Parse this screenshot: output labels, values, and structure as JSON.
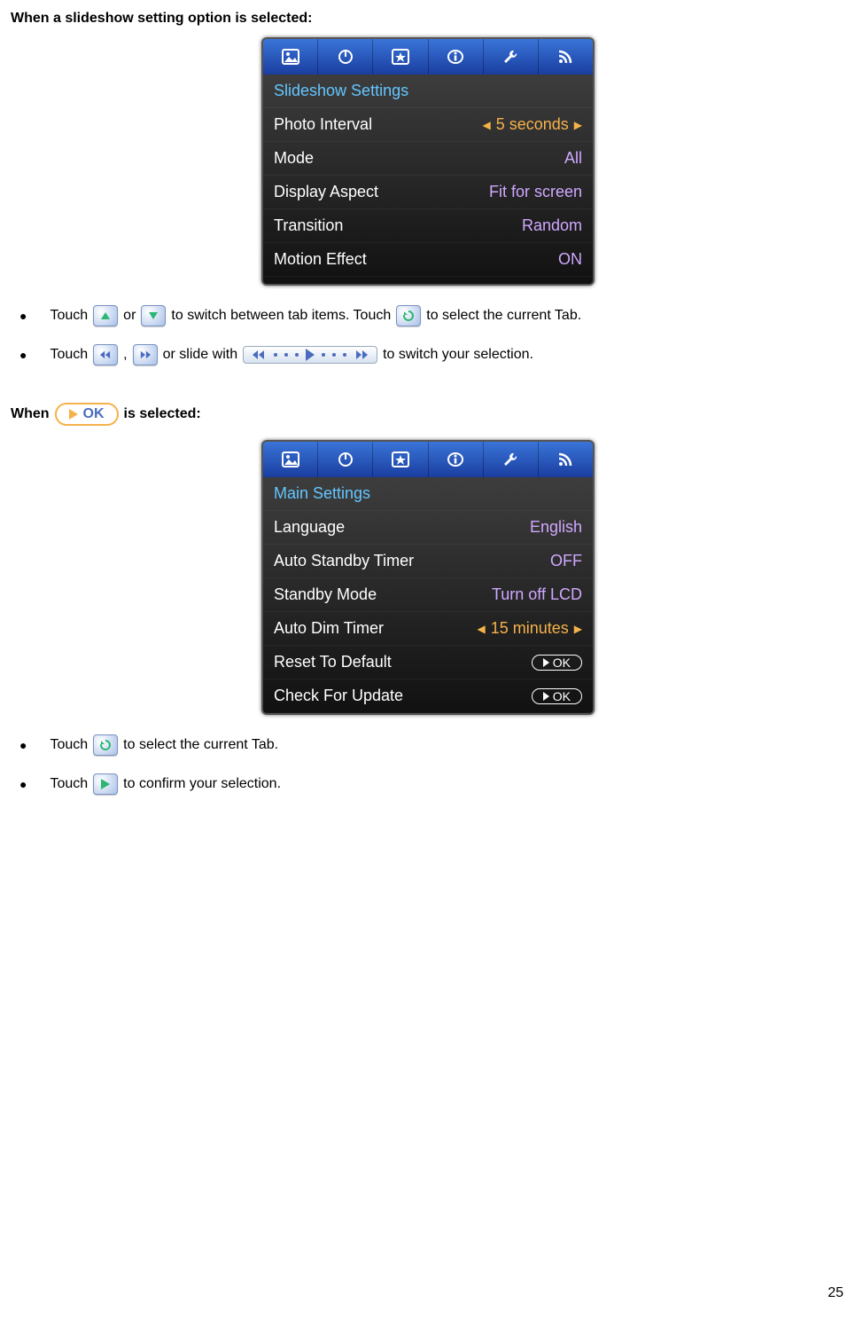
{
  "heading1": "When a slideshow setting option is selected:",
  "screenshot1": {
    "header": "Slideshow Settings",
    "rows": [
      {
        "label": "Photo Interval",
        "value": "5 seconds",
        "highlighted": true
      },
      {
        "label": "Mode",
        "value": "All"
      },
      {
        "label": "Display Aspect",
        "value": "Fit for screen"
      },
      {
        "label": "Transition",
        "value": "Random"
      },
      {
        "label": "Motion Effect",
        "value": "ON"
      }
    ]
  },
  "bullets1": {
    "b1": {
      "p1": "Touch",
      "p2": "or",
      "p3": "to switch between tab items. Touch",
      "p4": "to select the current Tab."
    },
    "b2": {
      "p1": "Touch",
      "comma": ",",
      "p2": "or slide with",
      "p3": "to switch your selection."
    }
  },
  "heading2": {
    "pre": "When",
    "post": "is selected:",
    "ok": "OK"
  },
  "screenshot2": {
    "header": "Main Settings",
    "rows": [
      {
        "label": "Language",
        "value": "English"
      },
      {
        "label": "Auto Standby Timer",
        "value": "OFF"
      },
      {
        "label": "Standby Mode",
        "value": "Turn off LCD"
      },
      {
        "label": "Auto Dim Timer",
        "value": "15 minutes",
        "highlighted": true
      },
      {
        "label": "Reset To Default",
        "value": "OK",
        "ok": true
      },
      {
        "label": "Check For Update",
        "value": "OK",
        "ok": true
      }
    ]
  },
  "bullets2": {
    "b1": {
      "p1": "Touch",
      "p2": "to select the current Tab."
    },
    "b2": {
      "p1": "Touch",
      "p2": "to confirm your selection."
    }
  },
  "pageNumber": "25"
}
